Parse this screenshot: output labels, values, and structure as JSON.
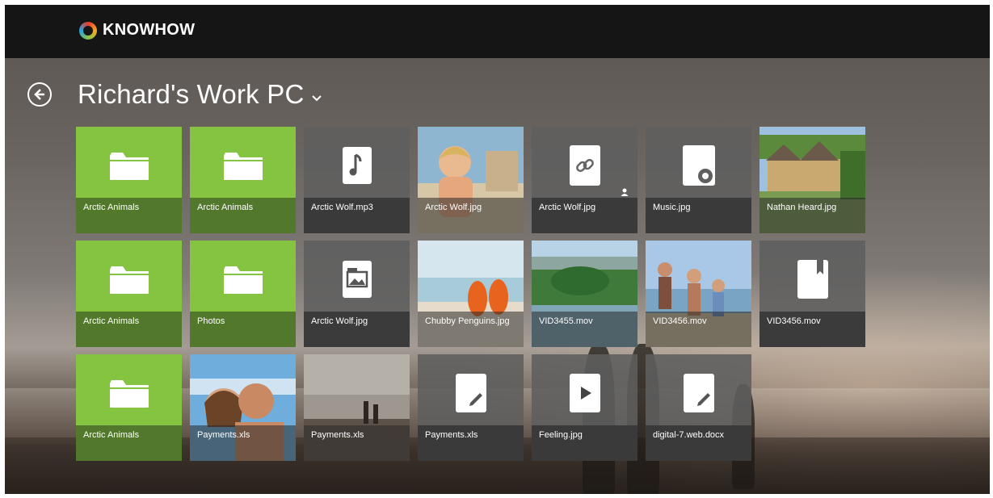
{
  "app": {
    "logo_text": "KNOWHOW"
  },
  "header": {
    "title": "Richard's Work PC"
  },
  "tiles": [
    {
      "label": "Arctic Animals",
      "type": "folder"
    },
    {
      "label": "Arctic Animals",
      "type": "folder"
    },
    {
      "label": "Arctic Wolf.mp3",
      "type": "music"
    },
    {
      "label": "Arctic Wolf.jpg",
      "type": "photo",
      "photo": "child"
    },
    {
      "label": "Arctic Wolf.jpg",
      "type": "link"
    },
    {
      "label": "Music.jpg",
      "type": "gear"
    },
    {
      "label": "Nathan Heard.jpg",
      "type": "photo",
      "photo": "village"
    },
    {
      "label": "Arctic Animals",
      "type": "folder"
    },
    {
      "label": "Photos",
      "type": "folder"
    },
    {
      "label": "Arctic Wolf.jpg",
      "type": "image"
    },
    {
      "label": "Chubby Penguins.jpg",
      "type": "photo",
      "photo": "flipflops"
    },
    {
      "label": "VID3455.mov",
      "type": "photo",
      "photo": "landscape"
    },
    {
      "label": "VID3456.mov",
      "type": "photo",
      "photo": "family"
    },
    {
      "label": "VID3456.mov",
      "type": "book"
    },
    {
      "label": "Arctic Animals",
      "type": "folder"
    },
    {
      "label": "Payments.xls",
      "type": "photo",
      "photo": "couple"
    },
    {
      "label": "Payments.xls",
      "type": "photo",
      "photo": "beach"
    },
    {
      "label": "Payments.xls",
      "type": "doc"
    },
    {
      "label": "Feeling.jpg",
      "type": "video"
    },
    {
      "label": "digital-7.web.docx",
      "type": "doc"
    }
  ]
}
